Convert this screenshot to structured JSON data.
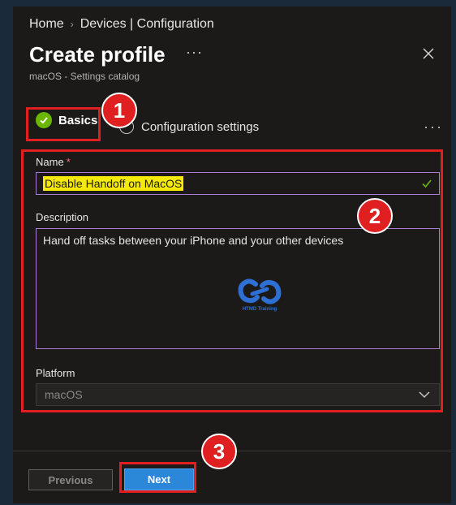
{
  "breadcrumb": {
    "home": "Home",
    "separator": "›",
    "current": "Devices | Configuration"
  },
  "header": {
    "title": "Create profile",
    "more": "···",
    "subtitle": "macOS - Settings catalog"
  },
  "steps": [
    {
      "label": "Basics",
      "state": "complete"
    },
    {
      "label": "Configuration settings",
      "state": "pending"
    }
  ],
  "steps_more": "···",
  "form": {
    "name_label": "Name",
    "name_required": "*",
    "name_value": "Disable Handoff on MacOS",
    "description_label": "Description",
    "description_value": "Hand off tasks between your iPhone and your other devices",
    "platform_label": "Platform",
    "platform_value": "macOS"
  },
  "watermark": {
    "text": "HTMD Training"
  },
  "annotations": [
    "1",
    "2",
    "3"
  ],
  "footer": {
    "previous_label": "Previous",
    "next_label": "Next"
  },
  "colors": {
    "accent": "#2b88d8",
    "annotation": "#e02020",
    "success": "#6bb700",
    "focus_border": "#a87fd4",
    "highlight": "#f5e90a"
  }
}
